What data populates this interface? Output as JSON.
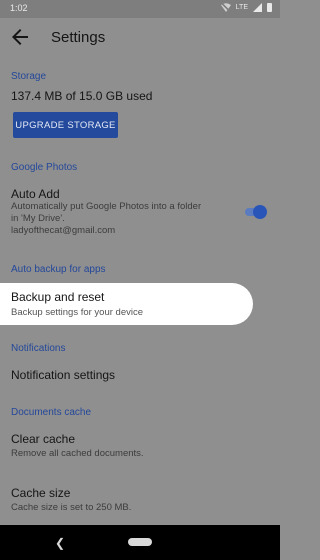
{
  "status_bar": {
    "time": "1:02",
    "network": "LTE"
  },
  "app_bar": {
    "title": "Settings"
  },
  "storage": {
    "header": "Storage",
    "usage": "137.4 MB of 15.0 GB used",
    "upgrade_label": "UPGRADE STORAGE"
  },
  "google_photos": {
    "header": "Google Photos",
    "auto_add_title": "Auto Add",
    "auto_add_summary_line1": "Automatically put Google Photos into a folder",
    "auto_add_summary_line2": "in 'My Drive'.",
    "account": "ladyofthecat@gmail.com",
    "toggle_on": true
  },
  "auto_backup": {
    "header": "Auto backup for apps",
    "backup_title": "Backup and reset",
    "backup_summary": "Backup settings for your device"
  },
  "notifications": {
    "header": "Notifications",
    "settings_title": "Notification settings"
  },
  "documents_cache": {
    "header": "Documents cache",
    "clear_title": "Clear cache",
    "clear_summary": "Remove all cached documents.",
    "size_title": "Cache size",
    "size_summary": "Cache size is set to 250 MB."
  },
  "colors": {
    "accent": "#234a9c",
    "scrim": "#8f8f8f",
    "highlight": "#ffffff"
  }
}
